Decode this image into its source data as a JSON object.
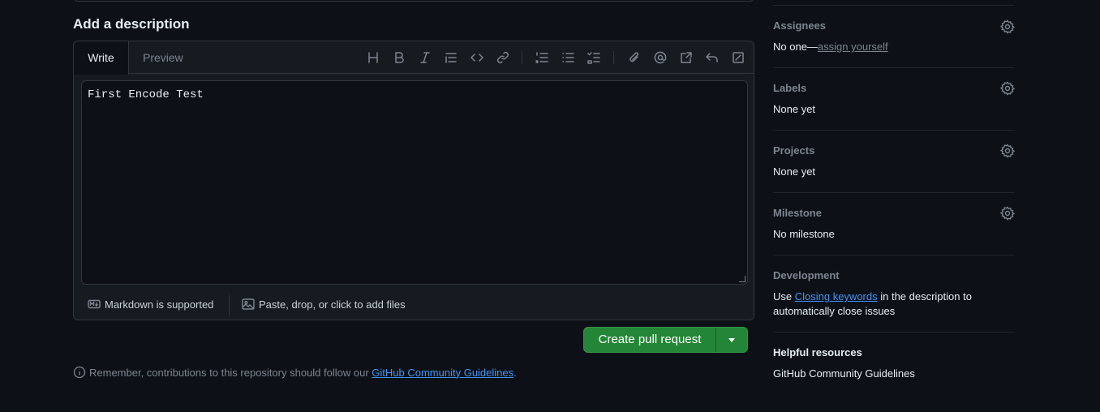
{
  "description": {
    "heading": "Add a description",
    "tabs": {
      "write": "Write",
      "preview": "Preview"
    },
    "toolbar_icons": [
      "heading-icon",
      "bold-icon",
      "italic-icon",
      "quote-icon",
      "code-icon",
      "link-icon",
      "ordered-list-icon",
      "unordered-list-icon",
      "task-list-icon",
      "attach-icon",
      "mention-icon",
      "reference-icon",
      "undo-icon",
      "fullscreen-icon"
    ],
    "heading_glyph": "H",
    "body_text": "First Encode Test",
    "markdown_label": "Markdown is supported",
    "attach_label": "Paste, drop, or click to add files"
  },
  "actions": {
    "create_label": "Create pull request",
    "button_color": "#238636"
  },
  "notice": {
    "prefix": "Remember, contributions to this repository should follow our ",
    "link": "GitHub Community Guidelines",
    "suffix": "."
  },
  "sidebar": {
    "assignees": {
      "title": "Assignees",
      "value_prefix": "No one—",
      "value_link": "assign yourself"
    },
    "labels": {
      "title": "Labels",
      "value": "None yet"
    },
    "projects": {
      "title": "Projects",
      "value": "None yet"
    },
    "milestone": {
      "title": "Milestone",
      "value": "No milestone"
    },
    "development": {
      "title": "Development",
      "text_prefix": "Use ",
      "link": "Closing keywords",
      "text_suffix": " in the description to automatically close issues"
    },
    "helpful": {
      "title": "Helpful resources",
      "link": "GitHub Community Guidelines"
    }
  },
  "colors": {
    "background": "#0d1117",
    "link": "#4493f8",
    "muted": "#7d8590"
  }
}
